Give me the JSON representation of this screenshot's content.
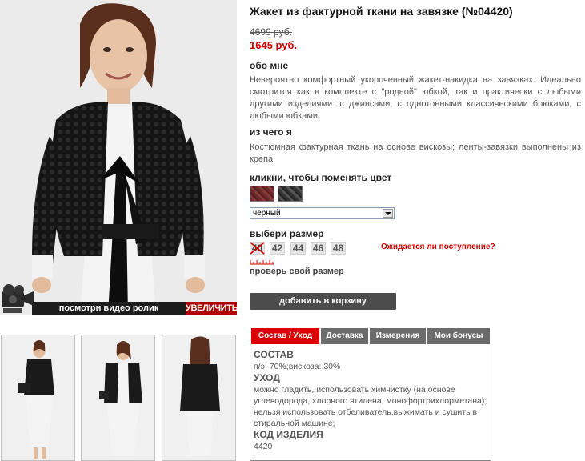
{
  "product": {
    "title": "Жакет из фактурной ткани на завязке (№04420)",
    "old_price": "4699 руб.",
    "new_price": "1645 руб."
  },
  "about": {
    "heading": "обо мне",
    "text": "Невероятно комфортный укороченный жакет-накидка на завязках. Идеально смотрится как в комплекте с \"родной\" юбкой, так и практически с любыми другими изделиями: с джинсами, с однотонными классическими брюками, с любыми юбками."
  },
  "material": {
    "heading": "из чего я",
    "text": "Костюмная фактурная ткань на основе вискозы; ленты-завязки выполнены из крепа"
  },
  "colors": {
    "heading": "кликни, чтобы поменять цвет",
    "swatches": [
      "бордовый",
      "черный"
    ],
    "selected": "черный"
  },
  "sizes": {
    "heading": "выбери размер",
    "items": [
      "40",
      "42",
      "44",
      "46",
      "48"
    ],
    "unavailable": [
      "40"
    ],
    "waiting_link": "Ожидается ли поступление?",
    "check_size": "проверь свой размер"
  },
  "cart": {
    "add_label": "добавить в корзину"
  },
  "media": {
    "video_label": "посмотри видео ролик",
    "zoom_label": "УВЕЛИЧИТЬ"
  },
  "tabs": {
    "items": [
      "Состав / Уход",
      "Доставка",
      "Измерения",
      "Мои бонусы"
    ],
    "active": "Состав / Уход"
  },
  "tab_content": {
    "composition_heading": "СОСТАВ",
    "composition": "п/э: 70%;вискоза: 30%",
    "care_heading": "УХОД",
    "care": "можно гладить, использовать химчистку (на основе углеводорода, хлорного этилена, монофортрихлорметана); нельзя использовать отбеливатель,выжимать и сушить в стиральной машине;",
    "code_heading": "КОД ИЗДЕЛИЯ",
    "code": "4420"
  },
  "colors_palette": {
    "accent_red": "#d40000",
    "tab_active": "#dd0000",
    "tab_inactive": "#6b6b6b",
    "button_dark": "#4c4c4c"
  }
}
